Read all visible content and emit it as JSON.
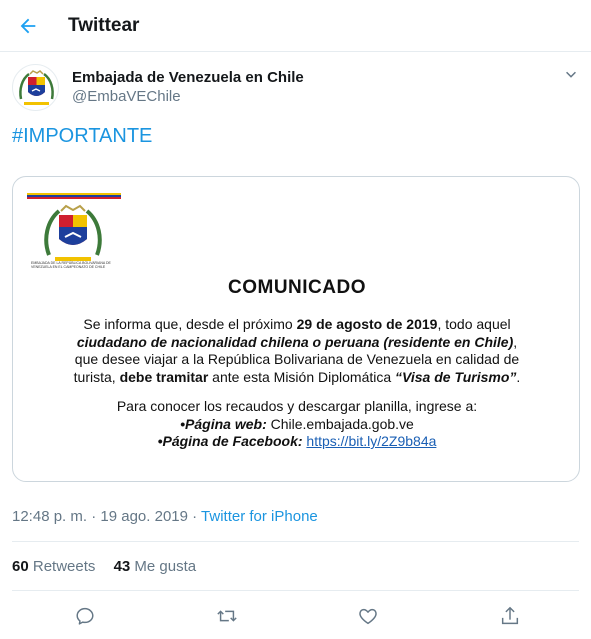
{
  "header": {
    "title": "Twittear",
    "back_icon": "arrow-left-icon",
    "accent": "#1da1f2"
  },
  "author": {
    "name": "Embajada de Venezuela en Chile",
    "handle": "@EmbaVEChile",
    "more_icon": "chevron-down-icon"
  },
  "tweet": {
    "hashtag": "#IMPORTANTE"
  },
  "image": {
    "seal_caption": "EMBAJADA DE LA REPÚBLICA BOLIVARIANA DE VENEZUELA EN EL CAMPEONATO DE CHILE",
    "title": "COMUNICADO",
    "l1a": "Se informa que, desde el próximo ",
    "l1b": "29 de agosto de 2019",
    "l1c": ", todo aquel",
    "l2a": "ciudadano de nacionalidad chilena o peruana (residente en Chile)",
    "l2b": ",",
    "l3": "que desee viajar a la República Bolivariana de Venezuela en calidad de",
    "l4a": "turista, ",
    "l4b": "debe tramitar",
    "l4c": " ante esta Misión Diplomática ",
    "l4d": "“Visa de Turismo”",
    "l4e": ".",
    "l5": "Para conocer los recaudos y descargar planilla, ingrese a:",
    "web_label": "•Página web:",
    "web_value": " Chile.embajada.gob.ve",
    "fb_label": "•Página de Facebook:",
    "fb_value": "https://bit.ly/2Z9b84a"
  },
  "meta": {
    "time": "12:48 p. m.",
    "separator": " · ",
    "date": "19 ago. 2019",
    "source": "Twitter for iPhone"
  },
  "stats": {
    "retweets_count": "60",
    "retweets_label": " Retweets",
    "likes_count": "43",
    "likes_label": " Me gusta"
  },
  "actions": {
    "icons": [
      "reply-icon",
      "retweet-icon",
      "like-icon",
      "share-icon"
    ],
    "color": "#657786"
  }
}
